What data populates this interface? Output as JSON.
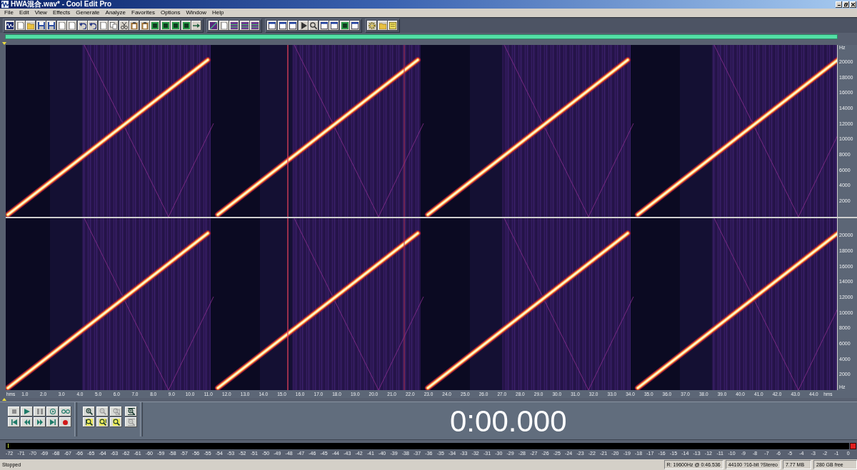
{
  "window": {
    "title": "HWA混合.wav* - Cool Edit Pro"
  },
  "menu": [
    "File",
    "Edit",
    "View",
    "Effects",
    "Generate",
    "Analyze",
    "Favorites",
    "Options",
    "Window",
    "Help"
  ],
  "channels": [
    {
      "axis": [
        {
          "kind": "unit",
          "text": "Hz"
        },
        {
          "kind": "tick",
          "text": "20000"
        },
        {
          "kind": "tick",
          "text": "18000"
        },
        {
          "kind": "tick",
          "text": "16000"
        },
        {
          "kind": "tick",
          "text": "14000"
        },
        {
          "kind": "tick",
          "text": "12000"
        },
        {
          "kind": "tick",
          "text": "10000"
        },
        {
          "kind": "tick",
          "text": "8000"
        },
        {
          "kind": "tick",
          "text": "6000"
        },
        {
          "kind": "tick",
          "text": "4000"
        },
        {
          "kind": "tick",
          "text": "2000"
        }
      ]
    },
    {
      "axis": [
        {
          "kind": "tick",
          "text": "20000"
        },
        {
          "kind": "tick",
          "text": "18000"
        },
        {
          "kind": "tick",
          "text": "16000"
        },
        {
          "kind": "tick",
          "text": "14000"
        },
        {
          "kind": "tick",
          "text": "12000"
        },
        {
          "kind": "tick",
          "text": "10000"
        },
        {
          "kind": "tick",
          "text": "8000"
        },
        {
          "kind": "tick",
          "text": "6000"
        },
        {
          "kind": "tick",
          "text": "4000"
        },
        {
          "kind": "tick",
          "text": "2000"
        },
        {
          "kind": "unit",
          "text": "Hz"
        }
      ]
    }
  ],
  "time_axis": {
    "unit_left": "hms",
    "labels": [
      "1.0",
      "2.0",
      "3.0",
      "4.0",
      "5.0",
      "6.0",
      "7.0",
      "8.0",
      "9.0",
      "10.0",
      "11.0",
      "12.0",
      "13.0",
      "14.0",
      "15.0",
      "16.0",
      "17.0",
      "18.0",
      "19.0",
      "20.0",
      "21.0",
      "22.0",
      "23.0",
      "24.0",
      "25.0",
      "26.0",
      "27.0",
      "28.0",
      "29.0",
      "30.0",
      "31.0",
      "32.0",
      "33.0",
      "34.0",
      "35.0",
      "36.0",
      "37.0",
      "38.0",
      "39.0",
      "40.0",
      "41.0",
      "42.0",
      "43.0",
      "44.0"
    ],
    "unit_right": "hms"
  },
  "transport": [
    {
      "kind": "stop",
      "disabled": true
    },
    {
      "kind": "play",
      "disabled": false
    },
    {
      "kind": "pause",
      "disabled": true
    },
    {
      "kind": "play-loop",
      "disabled": false
    },
    {
      "kind": "loop",
      "disabled": false
    },
    {
      "kind": "go-start",
      "disabled": false
    },
    {
      "kind": "rewind",
      "disabled": false
    },
    {
      "kind": "forward",
      "disabled": false
    },
    {
      "kind": "go-end",
      "disabled": false
    },
    {
      "kind": "record",
      "disabled": false
    }
  ],
  "zoom_buttons": [
    {
      "kind": "zoom-in",
      "disabled": false
    },
    {
      "kind": "zoom-out",
      "disabled": true
    },
    {
      "kind": "zoom-full",
      "disabled": true
    },
    {
      "kind": "zoom-left",
      "disabled": false
    },
    {
      "kind": "zoom-right",
      "disabled": false
    },
    {
      "kind": "zoom-selection",
      "disabled": false
    }
  ],
  "vertical_zoom_buttons": [
    {
      "kind": "zoom-in-vertical",
      "disabled": false
    },
    {
      "kind": "zoom-out-vertical",
      "disabled": true
    }
  ],
  "time_display": "0:00.000",
  "meter": {
    "clip": true,
    "labels": [
      "-72",
      "-71",
      "-70",
      "-69",
      "-68",
      "-67",
      "-66",
      "-65",
      "-64",
      "-63",
      "-62",
      "-61",
      "-60",
      "-59",
      "-58",
      "-57",
      "-56",
      "-55",
      "-54",
      "-53",
      "-52",
      "-51",
      "-50",
      "-49",
      "-48",
      "-47",
      "-46",
      "-45",
      "-44",
      "-43",
      "-42",
      "-41",
      "-40",
      "-39",
      "-38",
      "-37",
      "-36",
      "-35",
      "-34",
      "-33",
      "-32",
      "-31",
      "-30",
      "-29",
      "-28",
      "-27",
      "-26",
      "-25",
      "-24",
      "-23",
      "-22",
      "-21",
      "-20",
      "-19",
      "-18",
      "-17",
      "-16",
      "-15",
      "-14",
      "-13",
      "-12",
      "-11",
      "-10",
      "-9",
      "-8",
      "-7",
      "-6",
      "-5",
      "-4",
      "-3",
      "-2",
      "-1",
      "0"
    ]
  },
  "status_bar": {
    "state": "Stopped",
    "fields": [
      "R: 19600Hz @ 0:46.536",
      "44100 ?16-bit ?Stereo",
      "7.77 MB",
      "280 GB free"
    ]
  }
}
